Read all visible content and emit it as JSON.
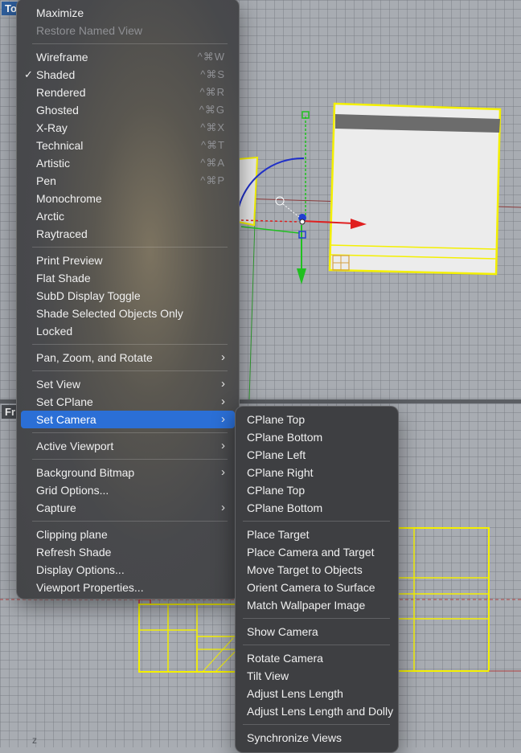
{
  "viewports": {
    "top_label": "To",
    "front_label": "Fr",
    "front_axis": "z"
  },
  "main_menu": {
    "items": [
      {
        "label": "Maximize"
      },
      {
        "label": "Restore Named View",
        "disabled": true
      },
      {
        "label": "Wireframe",
        "shortcut": "^⌘W"
      },
      {
        "label": "Shaded",
        "shortcut": "^⌘S",
        "checked": true
      },
      {
        "label": "Rendered",
        "shortcut": "^⌘R"
      },
      {
        "label": "Ghosted",
        "shortcut": "^⌘G"
      },
      {
        "label": "X-Ray",
        "shortcut": "^⌘X"
      },
      {
        "label": "Technical",
        "shortcut": "^⌘T"
      },
      {
        "label": "Artistic",
        "shortcut": "^⌘A"
      },
      {
        "label": "Pen",
        "shortcut": "^⌘P"
      },
      {
        "label": "Monochrome"
      },
      {
        "label": "Arctic"
      },
      {
        "label": "Raytraced"
      },
      {
        "label": "Print Preview"
      },
      {
        "label": "Flat Shade"
      },
      {
        "label": "SubD Display Toggle"
      },
      {
        "label": "Shade Selected Objects Only"
      },
      {
        "label": "Locked"
      },
      {
        "label": "Pan, Zoom, and Rotate",
        "submenu": true
      },
      {
        "label": "Set View",
        "submenu": true
      },
      {
        "label": "Set CPlane",
        "submenu": true
      },
      {
        "label": "Set Camera",
        "submenu": true,
        "selected": true
      },
      {
        "label": "Active Viewport",
        "submenu": true
      },
      {
        "label": "Background Bitmap",
        "submenu": true
      },
      {
        "label": "Grid Options..."
      },
      {
        "label": "Capture",
        "submenu": true
      },
      {
        "label": "Clipping plane"
      },
      {
        "label": "Refresh Shade"
      },
      {
        "label": "Display Options..."
      },
      {
        "label": "Viewport Properties..."
      }
    ]
  },
  "camera_submenu": {
    "items": [
      {
        "label": "CPlane Top"
      },
      {
        "label": "CPlane Bottom"
      },
      {
        "label": "CPlane Left"
      },
      {
        "label": "CPlane Right"
      },
      {
        "label": "CPlane Top"
      },
      {
        "label": "CPlane Bottom"
      },
      {
        "label": "Place Target"
      },
      {
        "label": "Place Camera and Target"
      },
      {
        "label": "Move Target to Objects"
      },
      {
        "label": "Orient Camera to Surface"
      },
      {
        "label": "Match Wallpaper Image"
      },
      {
        "label": "Show Camera"
      },
      {
        "label": "Rotate Camera"
      },
      {
        "label": "Tilt View"
      },
      {
        "label": "Adjust Lens Length"
      },
      {
        "label": "Adjust Lens Length and Dolly"
      },
      {
        "label": "Synchronize Views"
      }
    ]
  },
  "colors": {
    "selection": "#2b6fd6",
    "object_highlight": "#f4f000",
    "x_axis": "#e02020",
    "y_axis": "#20c020",
    "z_axis": "#2040d0"
  },
  "icons": {
    "checkmark": "✓",
    "submenu_arrow": "›"
  }
}
